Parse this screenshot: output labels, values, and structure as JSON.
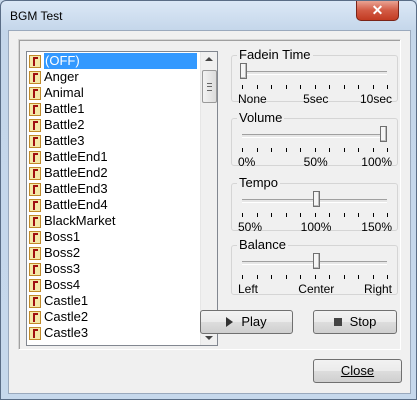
{
  "window": {
    "title": "BGM Test",
    "close_glyph": "✕"
  },
  "list": {
    "items": [
      "(OFF)",
      "Anger",
      "Animal",
      "Battle1",
      "Battle2",
      "Battle3",
      "BattleEnd1",
      "BattleEnd2",
      "BattleEnd3",
      "BattleEnd4",
      "BlackMarket",
      "Boss1",
      "Boss2",
      "Boss3",
      "Boss4",
      "Castle1",
      "Castle2",
      "Castle3"
    ],
    "selected_index": 0,
    "item_icon": "music-note-icon"
  },
  "fadein": {
    "label": "Fadein Time",
    "ticks": [
      "None",
      "5sec",
      "10sec"
    ],
    "value_fraction": 0.0
  },
  "volume": {
    "label": "Volume",
    "ticks": [
      "0%",
      "50%",
      "100%"
    ],
    "value_fraction": 1.0
  },
  "tempo": {
    "label": "Tempo",
    "ticks": [
      "50%",
      "100%",
      "150%"
    ],
    "value_fraction": 0.5
  },
  "balance": {
    "label": "Balance",
    "ticks": [
      "Left",
      "Center",
      "Right"
    ],
    "value_fraction": 0.5
  },
  "buttons": {
    "play": "Play",
    "stop": "Stop",
    "close": "Close"
  }
}
